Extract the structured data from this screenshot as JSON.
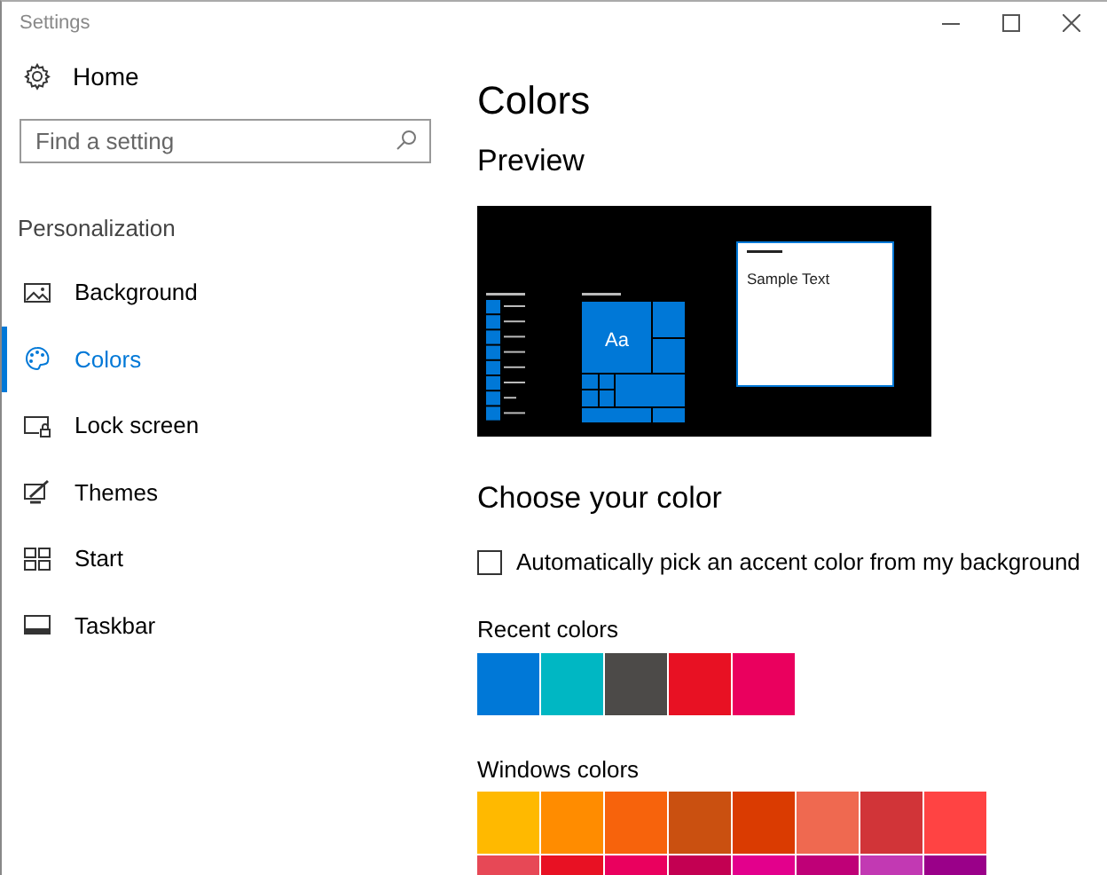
{
  "window": {
    "title": "Settings"
  },
  "sidebar": {
    "home": "Home",
    "search": {
      "placeholder": "Find a setting"
    },
    "section": "Personalization",
    "items": [
      {
        "label": "Background",
        "selected": false
      },
      {
        "label": "Colors",
        "selected": true
      },
      {
        "label": "Lock screen",
        "selected": false
      },
      {
        "label": "Themes",
        "selected": false
      },
      {
        "label": "Start",
        "selected": false
      },
      {
        "label": "Taskbar",
        "selected": false
      }
    ]
  },
  "page": {
    "title": "Colors",
    "preview_heading": "Preview",
    "preview": {
      "tile_text": "Aa",
      "sample_text": "Sample Text"
    },
    "choose_heading": "Choose your color",
    "auto_accent": {
      "label": "Automatically pick an accent color from my background",
      "checked": false
    },
    "recent_heading": "Recent colors",
    "recent_colors": [
      {
        "color": "#0078d7"
      },
      {
        "color": "#00b7c3"
      },
      {
        "color": "#4c4a48"
      },
      {
        "color": "#e81123"
      },
      {
        "color": "#ea005e"
      }
    ],
    "windows_heading": "Windows colors",
    "windows_colors": [
      {
        "color": "#ffb900"
      },
      {
        "color": "#ff8c00"
      },
      {
        "color": "#f7630c"
      },
      {
        "color": "#ca5010"
      },
      {
        "color": "#da3b01"
      },
      {
        "color": "#ef6950"
      },
      {
        "color": "#d13438"
      },
      {
        "color": "#ff4343"
      },
      {
        "color": "#e74856"
      },
      {
        "color": "#e81123"
      },
      {
        "color": "#ea005e"
      },
      {
        "color": "#c30052"
      },
      {
        "color": "#e3008c"
      },
      {
        "color": "#bf0077"
      },
      {
        "color": "#c239b3"
      },
      {
        "color": "#9a0089"
      }
    ]
  }
}
